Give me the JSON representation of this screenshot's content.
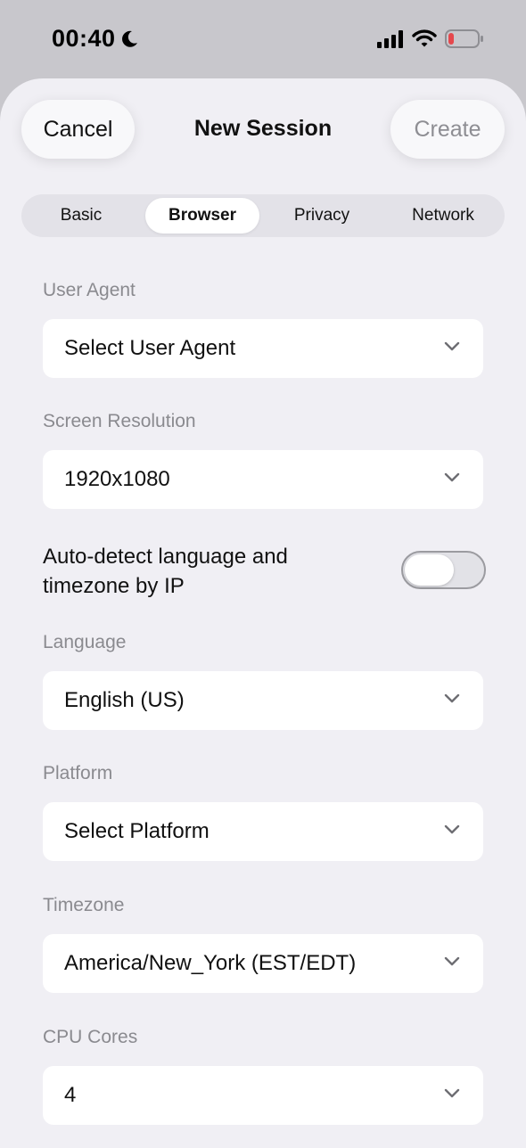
{
  "status_bar": {
    "time": "00:40",
    "icons": [
      "moon-icon",
      "cellular-signal-icon",
      "wifi-icon",
      "battery-low-icon"
    ],
    "battery_color": "#e5484d"
  },
  "header": {
    "cancel_label": "Cancel",
    "title": "New Session",
    "create_label": "Create"
  },
  "tabs": [
    {
      "label": "Basic",
      "active": false
    },
    {
      "label": "Browser",
      "active": true
    },
    {
      "label": "Privacy",
      "active": false
    },
    {
      "label": "Network",
      "active": false
    }
  ],
  "fields": {
    "user_agent": {
      "label": "User Agent",
      "value": "Select User Agent"
    },
    "screen_resolution": {
      "label": "Screen Resolution",
      "value": "1920x1080"
    },
    "language": {
      "label": "Language",
      "value": "English (US)"
    },
    "platform": {
      "label": "Platform",
      "value": "Select Platform"
    },
    "timezone": {
      "label": "Timezone",
      "value": "America/New_York (EST/EDT)"
    },
    "cpu_cores": {
      "label": "CPU Cores",
      "value": "4"
    }
  },
  "auto_detect": {
    "label": "Auto-detect language and timezone by IP",
    "enabled": false
  },
  "colors": {
    "sheet_background": "#f0eff4",
    "field_background": "#ffffff",
    "label_gray": "#8a8a8f"
  }
}
